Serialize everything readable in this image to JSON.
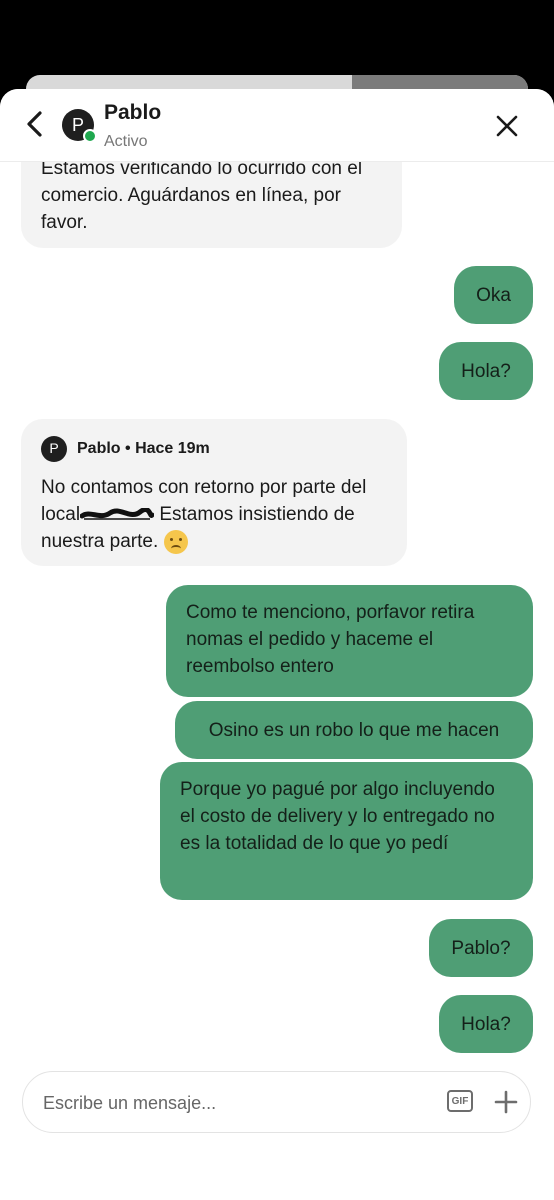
{
  "header": {
    "avatar_letter": "P",
    "name": "Pablo",
    "status": "Activo"
  },
  "messages": [
    {
      "direction": "in",
      "text": "Estamos verificando lo ocurrido con el comercio. Aguárdanos en línea, por favor."
    },
    {
      "direction": "out",
      "text": "Oka"
    },
    {
      "direction": "out",
      "text": "Hola?"
    },
    {
      "direction": "in",
      "sender": "Pablo",
      "time": "Hace 19m",
      "text_before": "No contamos con retorno por parte del local",
      "text_after": " Estamos insistiendo de nuestra parte. ",
      "emoji": "disappointed-face"
    },
    {
      "direction": "out",
      "text": "Como te menciono, porfavor retira nomas el pedido y haceme el reembolso entero"
    },
    {
      "direction": "out",
      "text": "Osino es un robo lo que me hacen"
    },
    {
      "direction": "out",
      "text": "Porque yo pagué por algo incluyendo el costo de delivery y lo entregado no es la totalidad de lo que yo pedí"
    },
    {
      "direction": "out",
      "text": "Pablo?"
    },
    {
      "direction": "out",
      "text": "Hola?"
    }
  ],
  "composer": {
    "placeholder": "Escribe un mensaje...",
    "gif_label": "GIF"
  },
  "colors": {
    "outgoing_bubble": "#4f9e75",
    "incoming_bubble": "#f3f3f3",
    "online_dot": "#1fa84f"
  },
  "icons": {
    "back": "chevron-left-icon",
    "close": "close-icon",
    "add": "plus-icon"
  }
}
